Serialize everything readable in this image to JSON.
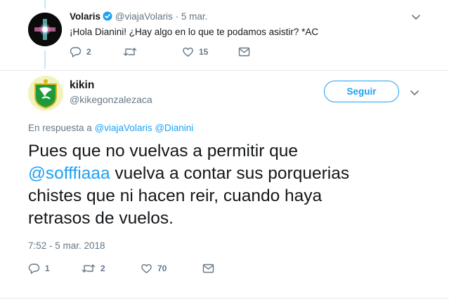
{
  "parent_tweet": {
    "author_name": "Volaris",
    "handle": "@viajaVolaris",
    "separator": "·",
    "date": "5 mar.",
    "text": "¡Hola Dianini! ¿Hay algo en lo que te podamos asistir? *AC",
    "replies": "2",
    "retweets": "",
    "likes": "15"
  },
  "main_tweet": {
    "author_name": "kikin",
    "handle": "@kikegonzalezaca",
    "follow_label": "Seguir",
    "reply_prefix": "En respuesta a",
    "reply_mentions": "@viajaVolaris @Dianini",
    "text_line1": "Pues que no vuelvas a permitir que",
    "text_mention": "@sofffiaaa",
    "text_after_mention": " vuelva a contar sus porquerias",
    "text_line3": "chistes que ni hacen reir, cuando haya",
    "text_line4": "retrasos de vuelos.",
    "timestamp": "7:52 - 5 mar. 2018",
    "replies": "1",
    "retweets": "2",
    "likes": "70"
  },
  "icons": {
    "verified": "verified-badge-icon",
    "reply": "reply-icon",
    "retweet": "retweet-icon",
    "like": "heart-icon",
    "message": "envelope-icon",
    "more": "chevron-down-icon"
  },
  "colors": {
    "accent": "#1da1f2",
    "secondary_text": "#657786",
    "thread_line": "#c4e8f5"
  }
}
